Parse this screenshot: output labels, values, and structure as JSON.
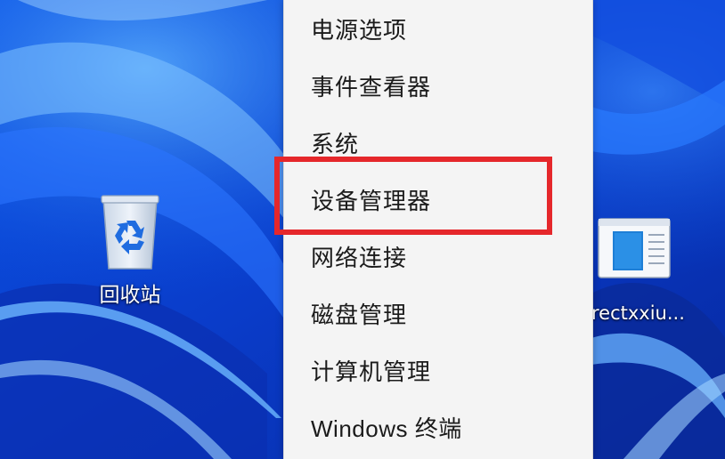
{
  "desktop": {
    "icons": [
      {
        "label": "回收站",
        "icon": "recycle-bin-icon"
      },
      {
        "label": "rectxxiu...",
        "icon": "document-file-icon"
      }
    ]
  },
  "context_menu": {
    "items": [
      {
        "label": "电源选项"
      },
      {
        "label": "事件查看器"
      },
      {
        "label": "系统"
      },
      {
        "label": "设备管理器"
      },
      {
        "label": "网络连接"
      },
      {
        "label": "磁盘管理"
      },
      {
        "label": "计算机管理"
      },
      {
        "label": "Windows 终端"
      }
    ],
    "highlighted_item": "设备管理器"
  },
  "colors": {
    "wallpaper_blue": "#0a3fd0",
    "menu_background": "#f4f4f4",
    "menu_text": "#1b1b1b",
    "highlight_red": "#e5272b"
  }
}
